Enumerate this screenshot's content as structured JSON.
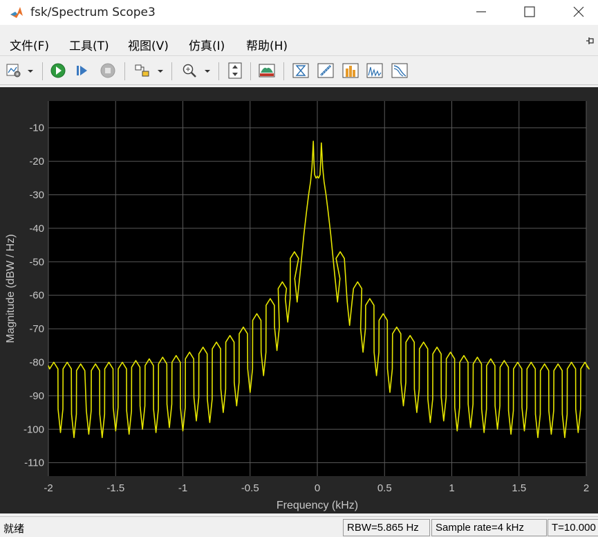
{
  "window": {
    "title": "fsk/Spectrum Scope3",
    "icon": "matlab-logo-icon"
  },
  "menu": [
    {
      "label": "文件(F)"
    },
    {
      "label": "工具(T)"
    },
    {
      "label": "视图(V)"
    },
    {
      "label": "仿真(I)"
    },
    {
      "label": "帮助(H)"
    }
  ],
  "toolbar": {
    "icons": [
      "scope-settings-icon",
      "run-icon",
      "step-forward-icon",
      "stop-icon",
      "highlight-block-icon",
      "zoom-icon",
      "autoscale-icon",
      "spectrum-settings-icon",
      "cursor-measurements-icon",
      "signal-statistics-icon",
      "peak-finder-icon",
      "distortion-icon",
      "ccdf-icon"
    ]
  },
  "status": {
    "left": "就绪",
    "rbw": "RBW=5.865 Hz",
    "sample_rate": "Sample rate=4 kHz",
    "time": "T=10.000"
  },
  "colors": {
    "plot_background": "#000000",
    "figure_background": "#262626",
    "trace": "#e6e600",
    "grid": "#5a5a5a",
    "axis_text": "#c8c8c8"
  },
  "chart_data": {
    "type": "line",
    "xlabel": "Frequency (kHz)",
    "ylabel": "Magnitude (dBW / Hz)",
    "xlim": [
      -2,
      2
    ],
    "ylim": [
      -114,
      -2
    ],
    "grid": true,
    "x_ticks": [
      "-2",
      "-1.5",
      "-1",
      "-0.5",
      "0",
      "0.5",
      "1",
      "1.5",
      "2"
    ],
    "x_tick_values": [
      -2,
      -1.5,
      -1,
      -0.5,
      0,
      0.5,
      1,
      1.5,
      2
    ],
    "y_ticks": [
      "-10",
      "-20",
      "-30",
      "-40",
      "-50",
      "-60",
      "-70",
      "-80",
      "-90",
      "-100",
      "-110"
    ],
    "y_tick_values": [
      -10,
      -20,
      -30,
      -40,
      -50,
      -60,
      -70,
      -80,
      -90,
      -100,
      -110
    ],
    "series": [
      {
        "lobe_peaks": [
          {
            "f": -1.96,
            "db": -80
          },
          {
            "f": -1.86,
            "db": -80
          },
          {
            "f": -1.76,
            "db": -80.5
          },
          {
            "f": -1.65,
            "db": -80.5
          },
          {
            "f": -1.55,
            "db": -80
          },
          {
            "f": -1.45,
            "db": -80
          },
          {
            "f": -1.35,
            "db": -79.5
          },
          {
            "f": -1.25,
            "db": -79
          },
          {
            "f": -1.15,
            "db": -78.5
          },
          {
            "f": -1.05,
            "db": -78
          },
          {
            "f": -0.95,
            "db": -77
          },
          {
            "f": -0.85,
            "db": -75.5
          },
          {
            "f": -0.75,
            "db": -74
          },
          {
            "f": -0.65,
            "db": -72
          },
          {
            "f": -0.55,
            "db": -69.5
          },
          {
            "f": -0.45,
            "db": -65.5
          },
          {
            "f": -0.35,
            "db": -61
          },
          {
            "f": -0.26,
            "db": -56
          },
          {
            "f": -0.17,
            "db": -47
          },
          {
            "f": 0.17,
            "db": -47
          },
          {
            "f": 0.3,
            "db": -56
          },
          {
            "f": 0.39,
            "db": -61
          },
          {
            "f": 0.49,
            "db": -65.5
          },
          {
            "f": 0.59,
            "db": -69.5
          },
          {
            "f": 0.69,
            "db": -72
          },
          {
            "f": 0.79,
            "db": -74
          },
          {
            "f": 0.89,
            "db": -75.5
          },
          {
            "f": 0.99,
            "db": -77
          },
          {
            "f": 1.09,
            "db": -78
          },
          {
            "f": 1.19,
            "db": -78.5
          },
          {
            "f": 1.29,
            "db": -79
          },
          {
            "f": 1.39,
            "db": -79.5
          },
          {
            "f": 1.49,
            "db": -80
          },
          {
            "f": 1.59,
            "db": -80
          },
          {
            "f": 1.69,
            "db": -80.5
          },
          {
            "f": 1.79,
            "db": -80.5
          },
          {
            "f": 1.89,
            "db": -80
          },
          {
            "f": 1.99,
            "db": -80
          }
        ],
        "nulls": [
          {
            "f": -1.91,
            "db": -101
          },
          {
            "f": -1.81,
            "db": -102.5
          },
          {
            "f": -1.7,
            "db": -101.5
          },
          {
            "f": -1.6,
            "db": -102.5
          },
          {
            "f": -1.5,
            "db": -100.5
          },
          {
            "f": -1.4,
            "db": -101.5
          },
          {
            "f": -1.3,
            "db": -100
          },
          {
            "f": -1.2,
            "db": -101
          },
          {
            "f": -1.1,
            "db": -99.5
          },
          {
            "f": -1.0,
            "db": -100.5
          },
          {
            "f": -0.9,
            "db": -97.5
          },
          {
            "f": -0.8,
            "db": -98
          },
          {
            "f": -0.7,
            "db": -95
          },
          {
            "f": -0.6,
            "db": -93
          },
          {
            "f": -0.5,
            "db": -89
          },
          {
            "f": -0.4,
            "db": -84
          },
          {
            "f": -0.3,
            "db": -76.5
          },
          {
            "f": -0.22,
            "db": -68
          },
          {
            "f": -0.15,
            "db": -62
          },
          {
            "f": 0.15,
            "db": -62
          },
          {
            "f": 0.24,
            "db": -69
          },
          {
            "f": 0.34,
            "db": -77
          },
          {
            "f": 0.44,
            "db": -84
          },
          {
            "f": 0.54,
            "db": -89
          },
          {
            "f": 0.64,
            "db": -93
          },
          {
            "f": 0.74,
            "db": -95
          },
          {
            "f": 0.84,
            "db": -98
          },
          {
            "f": 0.94,
            "db": -97.5
          },
          {
            "f": 1.04,
            "db": -100.5
          },
          {
            "f": 1.14,
            "db": -99.5
          },
          {
            "f": 1.24,
            "db": -101
          },
          {
            "f": 1.34,
            "db": -100
          },
          {
            "f": 1.44,
            "db": -101.5
          },
          {
            "f": 1.54,
            "db": -100.5
          },
          {
            "f": 1.64,
            "db": -102.5
          },
          {
            "f": 1.74,
            "db": -101.5
          },
          {
            "f": 1.84,
            "db": -102.5
          },
          {
            "f": 1.94,
            "db": -101
          }
        ],
        "main_lobe": [
          {
            "f": -0.12,
            "db": -50
          },
          {
            "f": -0.1,
            "db": -42
          },
          {
            "f": -0.08,
            "db": -35
          },
          {
            "f": -0.065,
            "db": -30
          },
          {
            "f": -0.05,
            "db": -26
          },
          {
            "f": -0.04,
            "db": -22
          },
          {
            "f": -0.035,
            "db": -18
          },
          {
            "f": -0.03,
            "db": -14
          },
          {
            "f": -0.025,
            "db": -20
          },
          {
            "f": -0.02,
            "db": -24
          },
          {
            "f": -0.01,
            "db": -25
          },
          {
            "f": 0.0,
            "db": -24.5
          },
          {
            "f": 0.01,
            "db": -25
          },
          {
            "f": 0.02,
            "db": -24
          },
          {
            "f": 0.025,
            "db": -20
          },
          {
            "f": 0.03,
            "db": -14.5
          },
          {
            "f": 0.035,
            "db": -18
          },
          {
            "f": 0.04,
            "db": -22
          },
          {
            "f": 0.05,
            "db": -26
          },
          {
            "f": 0.065,
            "db": -30
          },
          {
            "f": 0.08,
            "db": -35
          },
          {
            "f": 0.1,
            "db": -42
          },
          {
            "f": 0.12,
            "db": -50
          }
        ]
      }
    ]
  }
}
